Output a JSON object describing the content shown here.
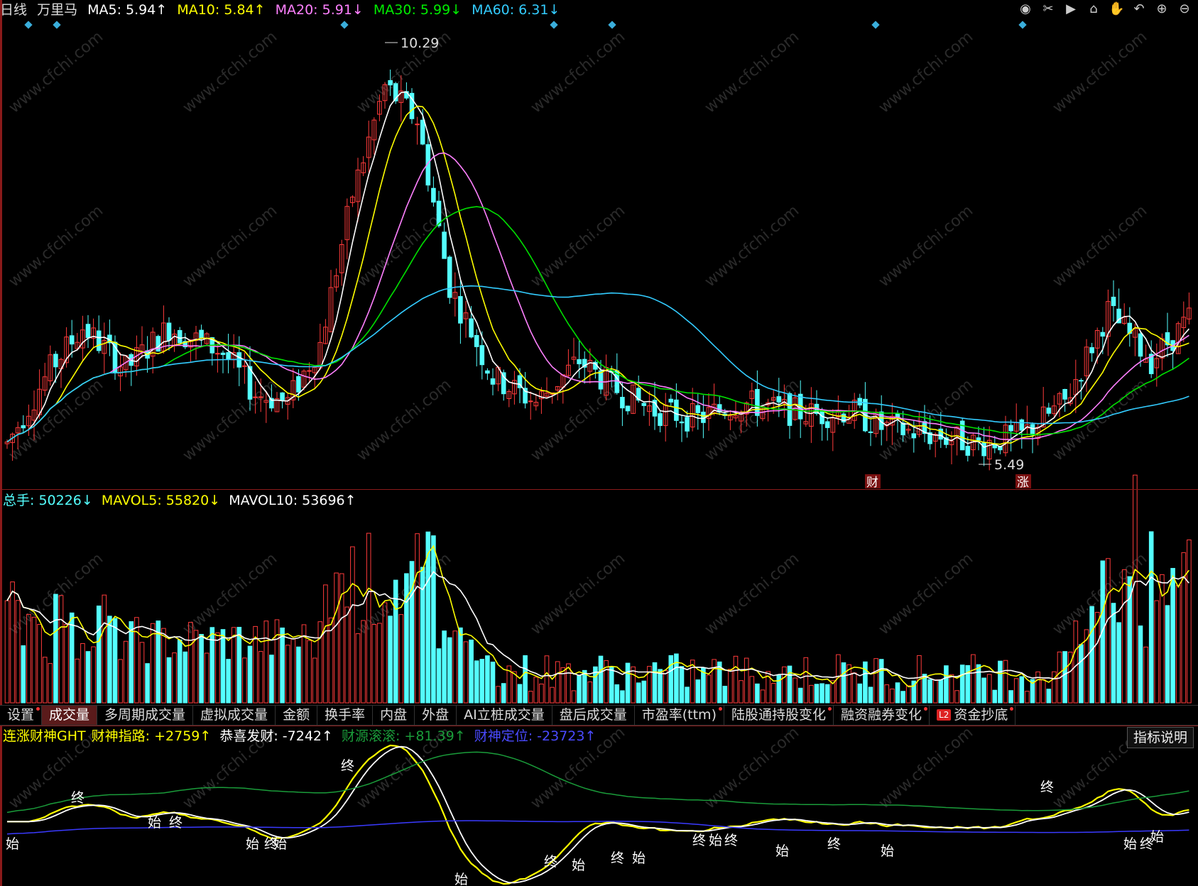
{
  "header": {
    "period": "日线",
    "stock_name": "万里马",
    "ma5": "MA5: 5.94↑",
    "ma10": "MA10: 5.84↑",
    "ma20": "MA20: 5.91↓",
    "ma30": "MA30: 5.99↓",
    "ma60": "MA60: 6.31↓"
  },
  "colors": {
    "up": "#ff3b3b",
    "down": "#54ffff",
    "ma5": "#ffffff",
    "ma10": "#ffff00",
    "ma20": "#ff80ff",
    "ma30": "#00e000",
    "ma60": "#33ccff",
    "white": "#ffffff",
    "yellow": "#ffff00",
    "green": "#1a9c3a",
    "blue": "#3a3aff",
    "label_cyan": "#54ffff"
  },
  "toolbar_icons": [
    "eye-icon",
    "scissors-icon",
    "play-icon",
    "lock-icon",
    "hand-icon",
    "undo-icon",
    "zoom-in-icon",
    "zoom-out-icon"
  ],
  "price_annotations": {
    "high": "10.29",
    "low": "5.49",
    "event1": "财",
    "event2": "涨"
  },
  "volume_legend": {
    "total": "总手: 50226↓",
    "mavol5": "MAVOL5: 55820↓",
    "mavol10": "MAVOL10: 53696↑"
  },
  "tabs": [
    {
      "label": "设置",
      "dot": true
    },
    {
      "label": "成交量",
      "active": true
    },
    {
      "label": "多周期成交量"
    },
    {
      "label": "虚拟成交量"
    },
    {
      "label": "金额"
    },
    {
      "label": "换手率"
    },
    {
      "label": "内盘"
    },
    {
      "label": "外盘"
    },
    {
      "label": "AI立桩成交量"
    },
    {
      "label": "盘后成交量"
    },
    {
      "label": "市盈率(ttm)",
      "dot": true
    },
    {
      "label": "陆股通持股变化",
      "dot": true
    },
    {
      "label": "融资融券变化",
      "dot": true
    },
    {
      "label": "资金抄底",
      "dot": true,
      "badge": "L2"
    }
  ],
  "indicator_legend": {
    "name": "连涨财神GHT",
    "line1": "财神指路: +2759↑",
    "line2": "恭喜发财: -7242↑",
    "line3": "财源滚滚: +81.39↑",
    "line4": "财神定位: -23723↑"
  },
  "explain_button": "指标说明",
  "signals": {
    "start": "始",
    "end": "终"
  },
  "watermark": "www.cfchi.com",
  "chart_data": {
    "type": "candlestick",
    "price_range": [
      5.2,
      10.5
    ],
    "high_price": 10.29,
    "low_price": 5.49
  }
}
